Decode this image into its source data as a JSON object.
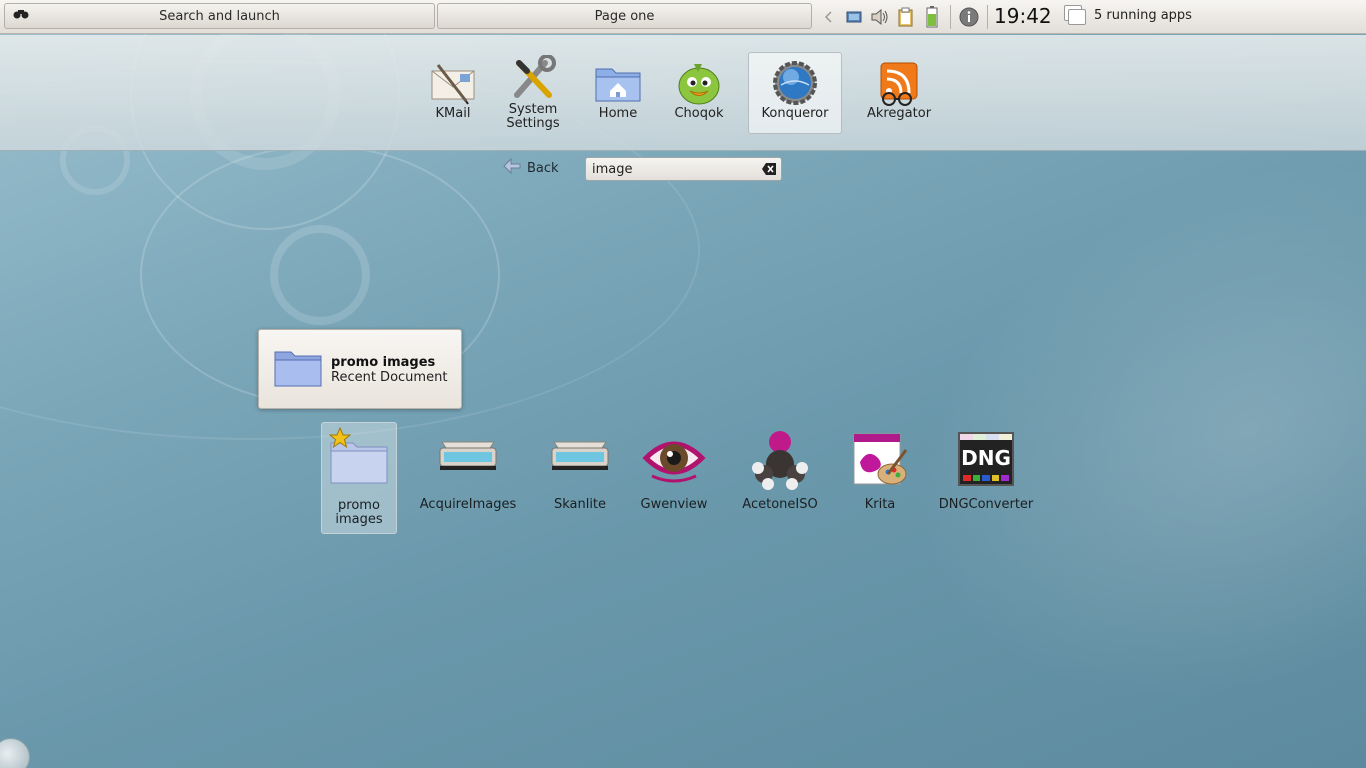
{
  "panel": {
    "search_launch_label": "Search and launch",
    "page_label": "Page one",
    "clock": "19:42",
    "running_apps": "5 running apps"
  },
  "favorites": [
    {
      "label": "KMail",
      "icon": "kmail-icon"
    },
    {
      "label": "System\nSettings",
      "icon": "system-settings-icon"
    },
    {
      "label": "Home",
      "icon": "home-folder-icon"
    },
    {
      "label": "Choqok",
      "icon": "choqok-icon"
    },
    {
      "label": "Konqueror",
      "icon": "konqueror-icon"
    },
    {
      "label": "Akregator",
      "icon": "akregator-icon"
    }
  ],
  "search": {
    "back_label": "Back",
    "query": "image"
  },
  "tooltip": {
    "title": "promo images",
    "subtitle": "Recent Document"
  },
  "results": [
    {
      "label": "promo\nimages",
      "icon": "folder-icon"
    },
    {
      "label": "AcquireImages",
      "icon": "scanner-icon"
    },
    {
      "label": "Skanlite",
      "icon": "scanner-icon"
    },
    {
      "label": "Gwenview",
      "icon": "gwenview-icon"
    },
    {
      "label": "AcetoneISO",
      "icon": "acetoneiso-icon"
    },
    {
      "label": "Krita",
      "icon": "krita-icon"
    },
    {
      "label": "DNGConverter",
      "icon": "dng-converter-icon"
    }
  ],
  "dng_badge": "DNG"
}
